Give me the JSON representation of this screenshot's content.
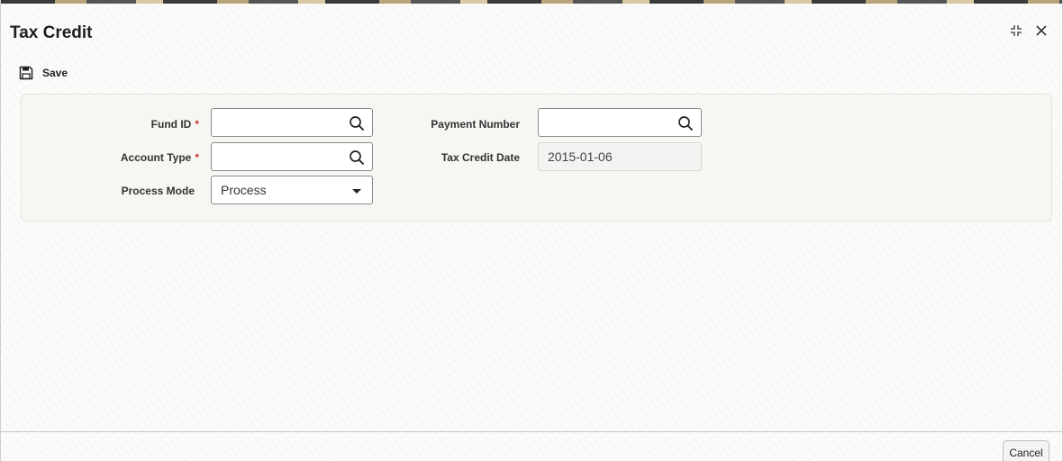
{
  "window": {
    "title": "Tax Credit"
  },
  "toolbar": {
    "save_label": "Save"
  },
  "form": {
    "fund_id": {
      "label": "Fund ID",
      "required_mark": "*",
      "value": ""
    },
    "account_type": {
      "label": "Account Type",
      "required_mark": "*",
      "value": ""
    },
    "process_mode": {
      "label": "Process Mode",
      "value": "Process"
    },
    "payment_number": {
      "label": "Payment Number",
      "value": ""
    },
    "tax_credit_date": {
      "label": "Tax Credit Date",
      "value": "2015-01-06"
    }
  },
  "footer": {
    "cancel_label": "Cancel"
  },
  "icons": {
    "save": "save-icon",
    "search": "search-icon",
    "dropdown": "caret-down-icon",
    "restore": "restore-icon",
    "close": "close-icon"
  },
  "colors": {
    "required": "#c0392b",
    "title": "#1e1e1e"
  }
}
